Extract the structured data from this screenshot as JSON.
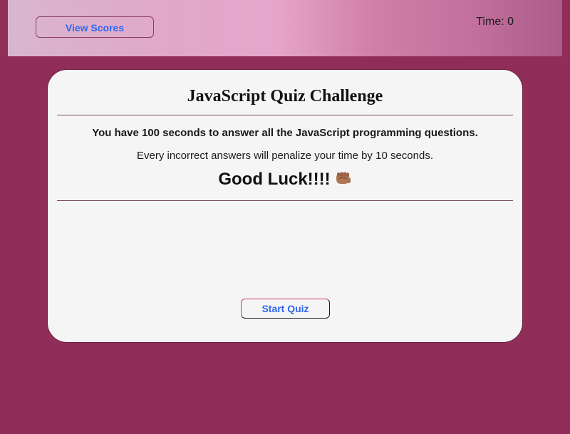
{
  "header": {
    "view_scores_label": "View Scores",
    "timer_text": "Time: 0"
  },
  "quiz": {
    "title": "JavaScript Quiz Challenge",
    "intro_line_1": "You have 100 seconds to answer all the JavaScript programming questions.",
    "intro_line_2": "Every incorrect answers will penalize your time by 10 seconds.",
    "good_luck": "Good Luck!!!!",
    "good_luck_icon": "fist-bump-icon",
    "start_label": "Start Quiz"
  },
  "colors": {
    "page_background": "#912d59",
    "card_background": "#f5f5f5",
    "button_text": "#2f67f0",
    "header_gradient": [
      "#d9b6cf",
      "#e6a6cb",
      "#ab5c88"
    ]
  }
}
